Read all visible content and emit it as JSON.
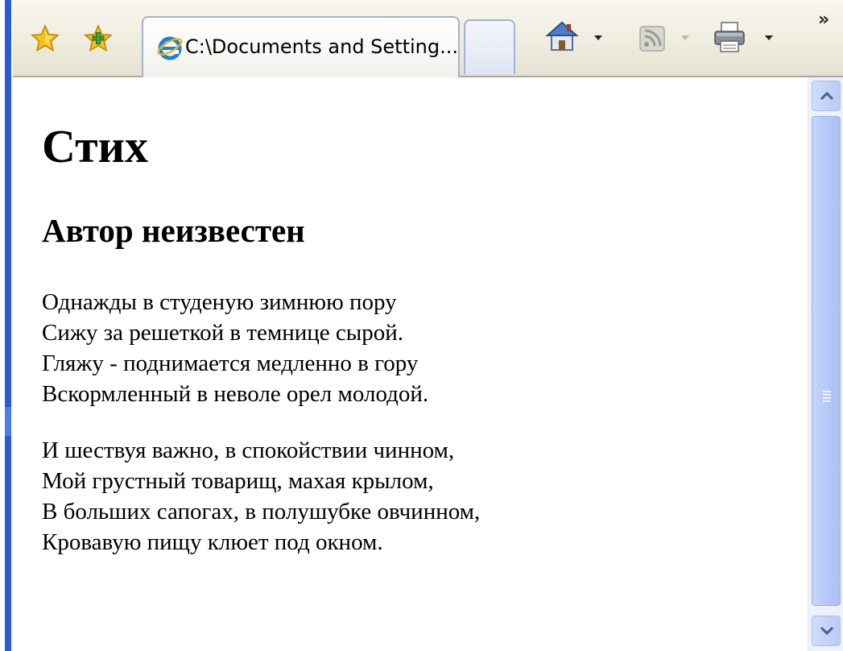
{
  "toolbar": {
    "favorites_icon": "favorites-star-icon",
    "add_favorite_icon": "add-favorite-icon",
    "tab": {
      "title": "C:\\Documents and Setting...",
      "icon": "ie-logo-icon"
    },
    "new_tab_icon": "new-tab-icon",
    "home_icon": "home-icon",
    "feeds_icon": "rss-feeds-icon",
    "print_icon": "printer-icon",
    "more_label": "»"
  },
  "page": {
    "title": "Стих",
    "author": "Автор неизвестен",
    "stanzas": [
      {
        "lines": [
          "Однажды в студеную зимнюю пору",
          "Сижу за решеткой в темнице сырой.",
          "Гляжу - поднимается медленно в гору",
          "Вскормленный в неволе орел молодой."
        ]
      },
      {
        "lines": [
          "И шествуя важно, в спокойствии чинном,",
          "Мой грустный товарищ, махая крылом,",
          "В больших сапогах, в полушубке овчинном,",
          "Кровавую пищу клюет под окном."
        ]
      }
    ]
  },
  "colors": {
    "frame_blue": "#2a5bd8",
    "scroll_blue": "#b3c8f8",
    "toolbar_bg": "#efece0"
  }
}
